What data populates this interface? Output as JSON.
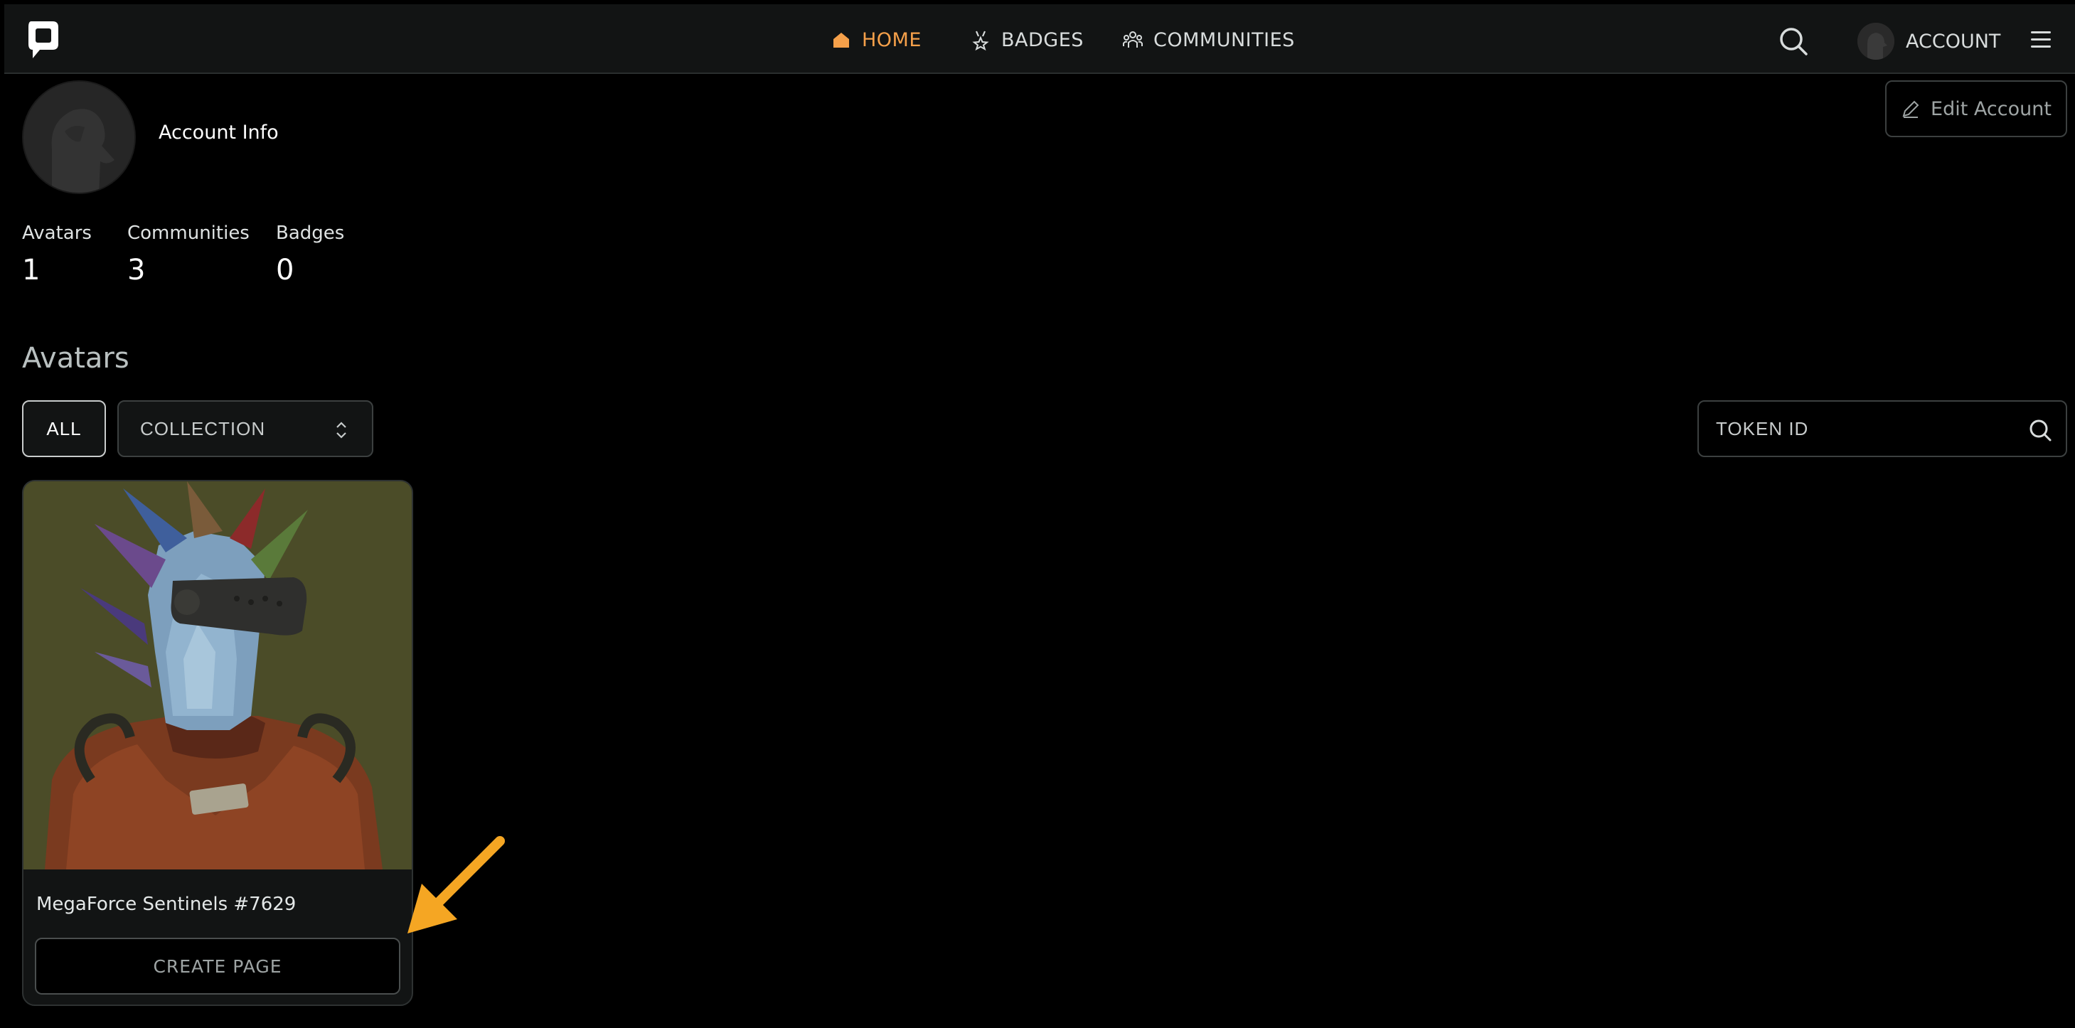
{
  "nav": {
    "home": "HOME",
    "badges": "BADGES",
    "communities": "COMMUNITIES",
    "account": "ACCOUNT"
  },
  "profile": {
    "title": "Account Info",
    "edit_label": "Edit Account"
  },
  "stats": [
    {
      "label": "Avatars",
      "value": "1"
    },
    {
      "label": "Communities",
      "value": "3"
    },
    {
      "label": "Badges",
      "value": "0"
    }
  ],
  "avatars_section": {
    "title": "Avatars",
    "filter_all": "ALL",
    "filter_collection": "COLLECTION",
    "token_placeholder": "TOKEN ID"
  },
  "card": {
    "name": "MegaForce Sentinels #7629",
    "action": "CREATE PAGE"
  },
  "colors": {
    "accent": "#f5a04a",
    "arrow": "#f5a623",
    "background": "#000000",
    "panel": "#121414"
  },
  "icons": [
    "logo-icon",
    "home-icon",
    "badge-icon",
    "communities-icon",
    "search-icon",
    "avatar-icon",
    "menu-icon",
    "edit-icon",
    "chevron-updown-icon"
  ]
}
